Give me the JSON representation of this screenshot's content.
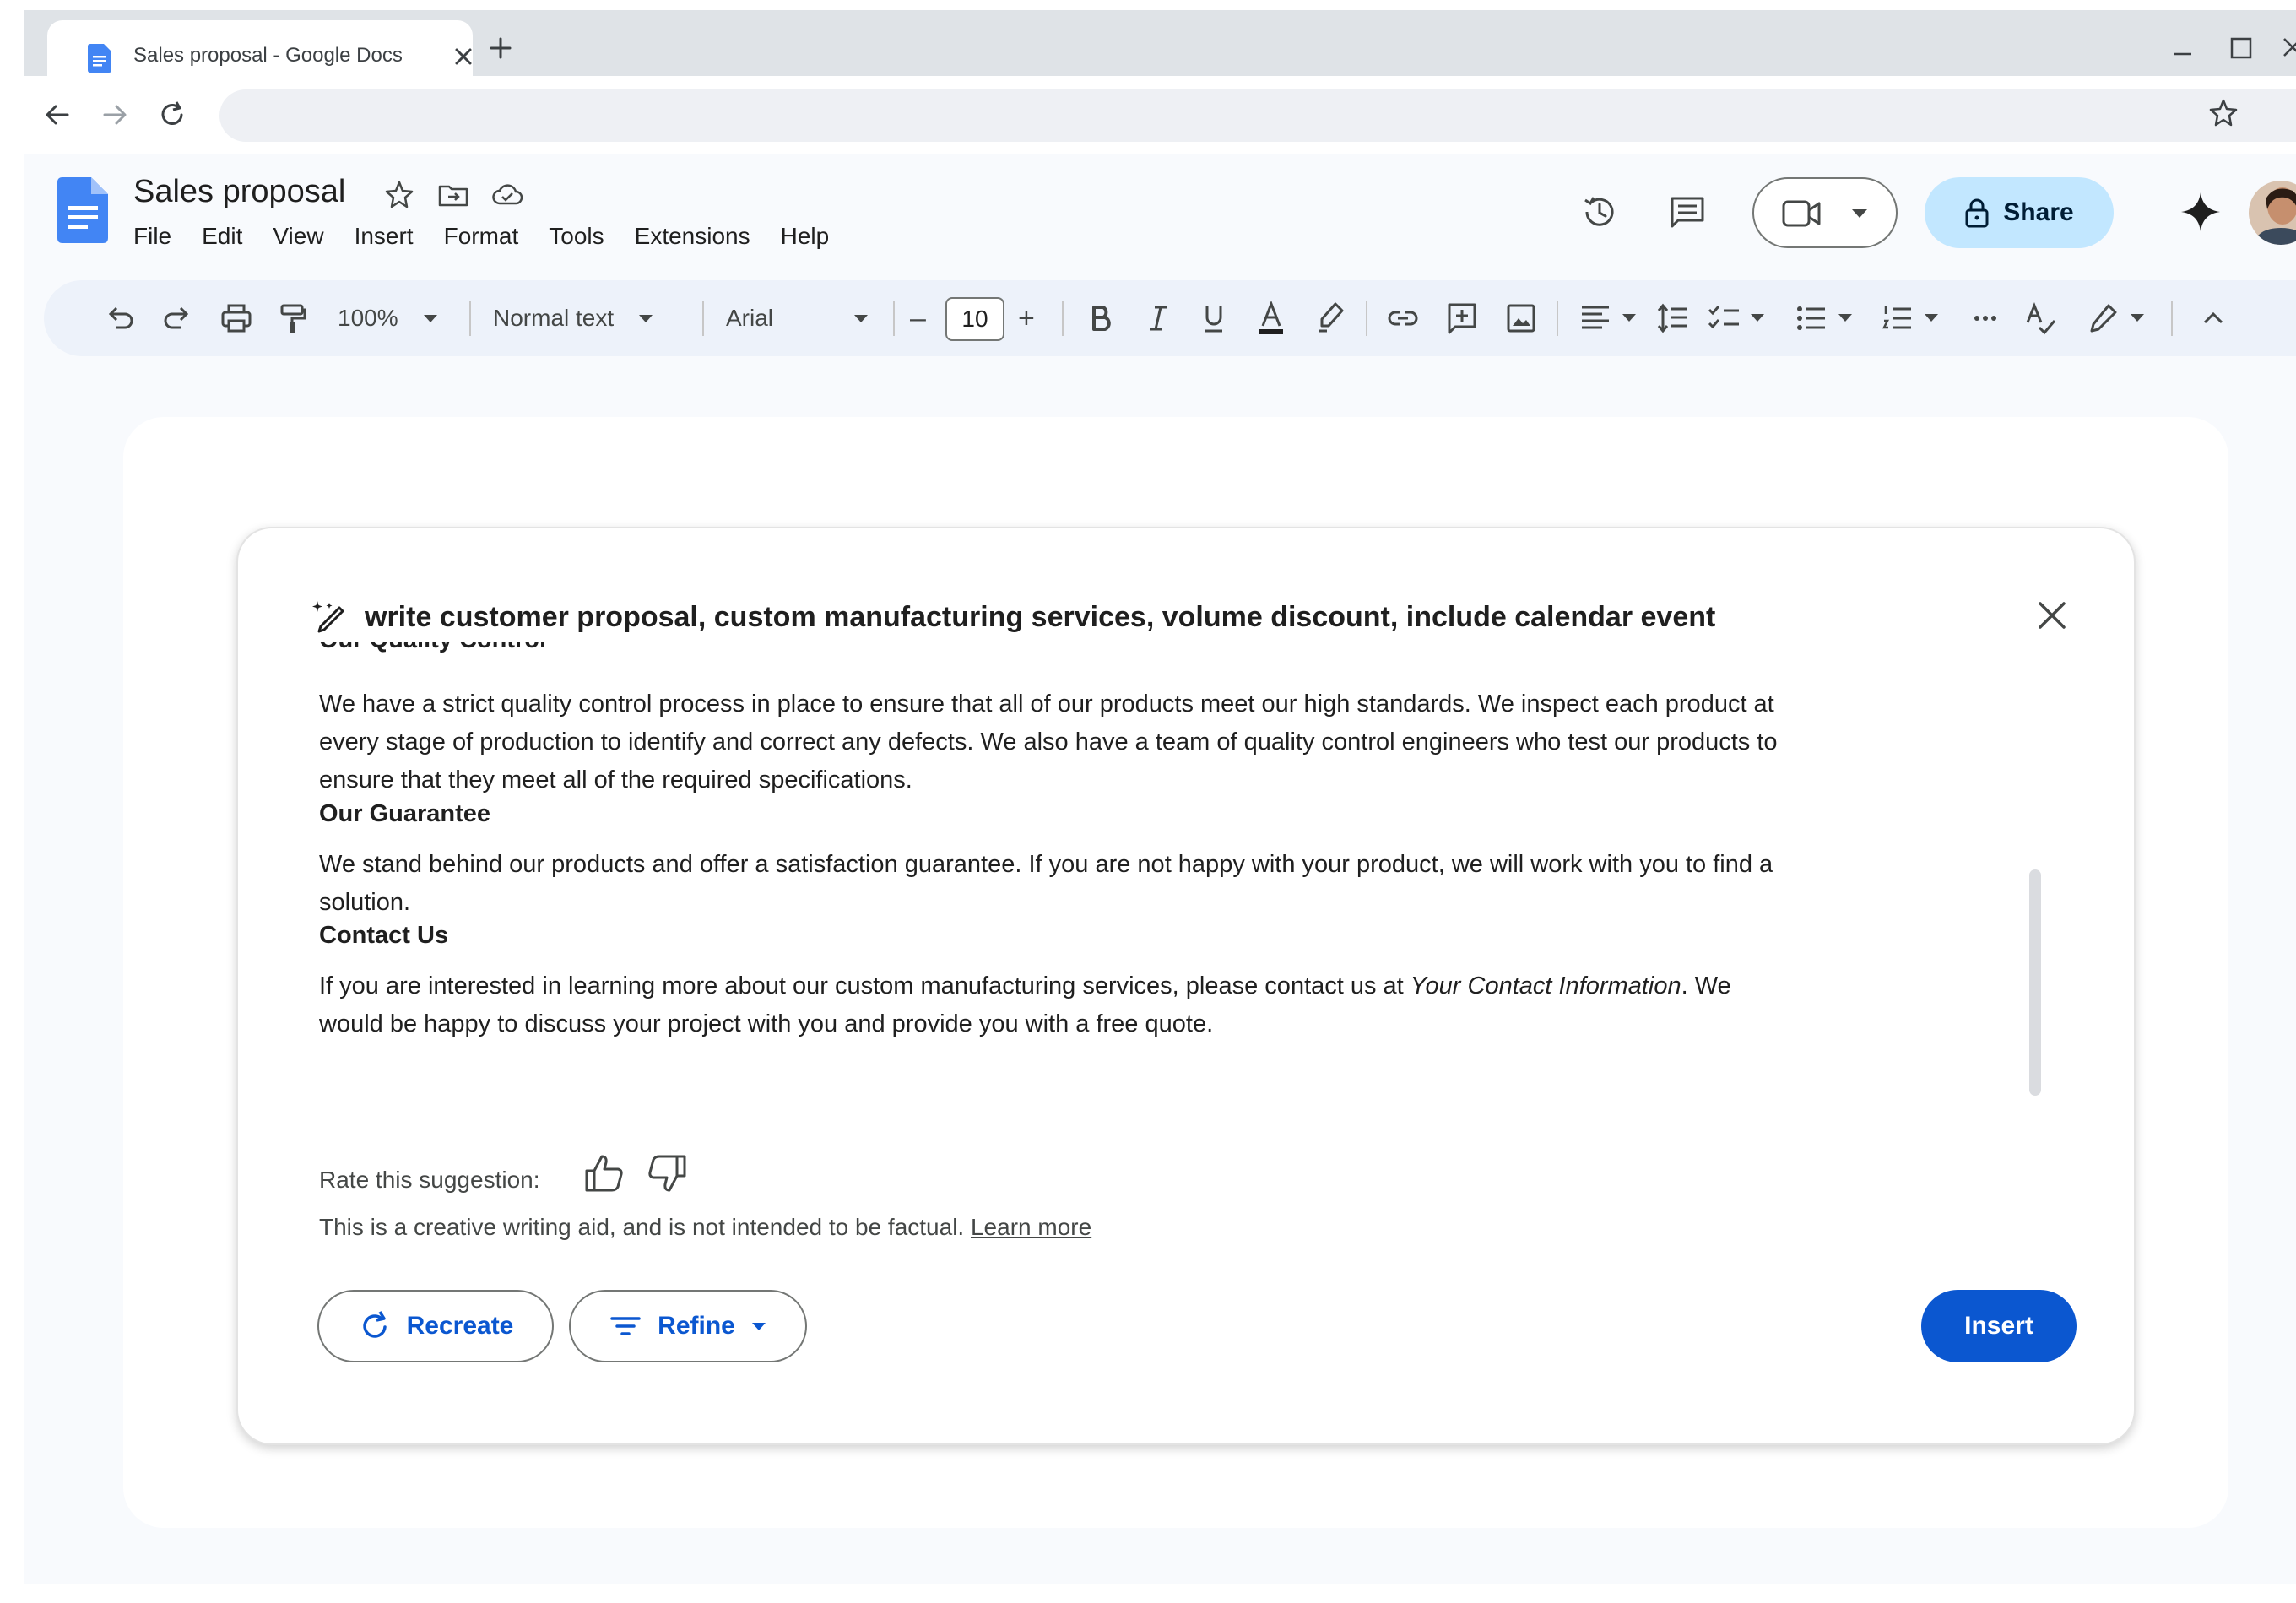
{
  "browser": {
    "tab_title": "Sales proposal - Google Docs",
    "new_tab_symbol": "+"
  },
  "docs": {
    "title": "Sales proposal",
    "menu": [
      "File",
      "Edit",
      "View",
      "Insert",
      "Format",
      "Tools",
      "Extensions",
      "Help"
    ],
    "share_label": "Share"
  },
  "toolbar": {
    "zoom": "100%",
    "style": "Normal text",
    "font": "Arial",
    "font_size": "10",
    "minus": "–",
    "plus": "+"
  },
  "card": {
    "prompt": "write customer proposal, custom manufacturing services, volume discount, include calendar event",
    "peek_heading": "Our Quality Control",
    "sections": [
      {
        "text": "We have a strict quality control process in place to ensure that all of our products meet our high standards. We inspect each product at every stage of production to identify and correct any defects. We also have a team of quality control engineers who test our products to ensure that they meet all of the required specifications."
      },
      {
        "heading": "Our Guarantee",
        "text": "We stand behind our products and offer a satisfaction guarantee. If you are not happy with your product, we will work with you to find a solution."
      },
      {
        "heading": "Contact Us",
        "text_before": "If you are interested in learning more about our custom manufacturing services, please contact us at ",
        "text_italic": "Your Contact Information",
        "text_after": ". We would be happy to discuss your project with you and provide you with a free quote."
      }
    ],
    "rate_label": "Rate this suggestion:",
    "disclaimer": "This is a creative writing aid, and is not intended to be factual.",
    "learn_more": "Learn more",
    "recreate_label": "Recreate",
    "refine_label": "Refine",
    "insert_label": "Insert"
  },
  "colors": {
    "accent": "#0b57d0",
    "share_bg": "#c2e7ff",
    "toolbar_bg": "#edf2fa",
    "docs_blue": "#4285f4"
  },
  "icons": [
    "docs-logo-icon",
    "close-icon",
    "star-icon",
    "folder-move-icon",
    "cloud-icon",
    "history-icon",
    "comment-icon",
    "video-icon",
    "lock-icon",
    "gemini-sparkle-icon",
    "undo-icon",
    "redo-icon",
    "print-icon",
    "paint-format-icon",
    "bold-icon",
    "italic-icon",
    "underline-icon",
    "text-color-icon",
    "highlight-icon",
    "link-icon",
    "add-comment-icon",
    "image-icon",
    "align-icon",
    "line-spacing-icon",
    "checklist-icon",
    "bullet-list-icon",
    "numbered-list-icon",
    "more-icon",
    "spellcheck-icon",
    "pen-icon",
    "chevron-up-icon",
    "pencil-sparkle-icon",
    "thumbs-up-icon",
    "thumbs-down-icon",
    "refresh-icon",
    "filter-icon"
  ]
}
